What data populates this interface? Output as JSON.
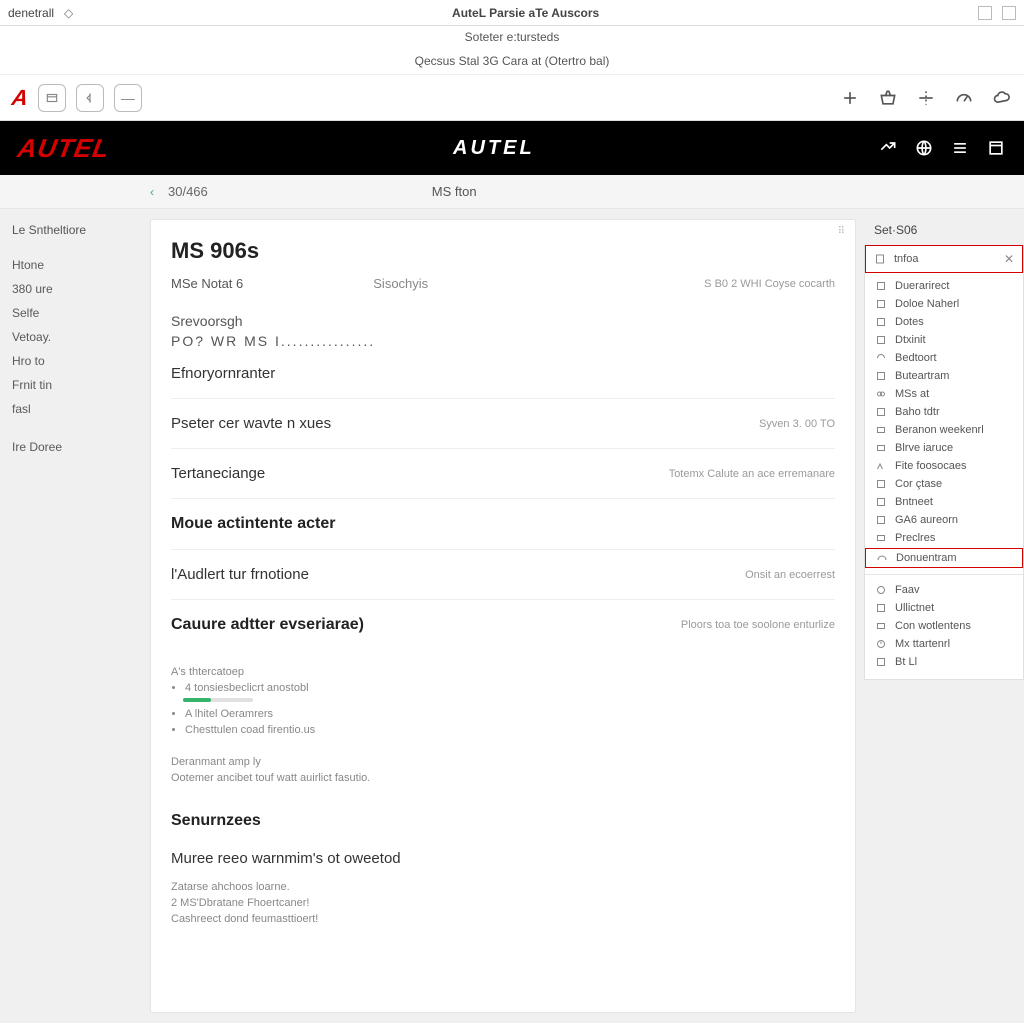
{
  "os": {
    "left_label": "denetrall",
    "window_title": "AuteL Parsie aTe Auscors",
    "subtitle": "Soteter e:tursteds",
    "caption": "Qecsus Stal 3G Cara at (Otertro bal)"
  },
  "site_header": {
    "brand": "AUTEL",
    "brand_center": "AUTEL"
  },
  "crumb": {
    "code": "30/466",
    "page": "MS fton"
  },
  "left_nav": {
    "heading": "Le Sntheltiore",
    "group1": [
      "Htone",
      "380 ure",
      "Selfe",
      "Vetoay.",
      "Hro to",
      "Frnit tin",
      "fasl"
    ],
    "group2": [
      "Ire Doree"
    ]
  },
  "main": {
    "title": "MS 906s",
    "meta1": "MSe Notat 6",
    "meta2": "Sisochyis",
    "meta3": "S B0 2 WHI Coyse cocarth",
    "sub1": "Srevoorsgh",
    "dots": "PO? WR MS I................",
    "sections": [
      {
        "title": "Efnoryornranter",
        "right": ""
      },
      {
        "title": "Pseter cer wavte n xues",
        "right": "Syven 3. 00 TO"
      },
      {
        "title": "Tertaneciange",
        "right": "Totemx Calute an ace erremanare"
      },
      {
        "title": "Moue actintente acter",
        "right": "",
        "big": true
      },
      {
        "title": "l'Audlert tur frnotione",
        "right": "Onsit an ecoerrest"
      },
      {
        "title": "Cauure adtter evseriarae)",
        "right": "Ploors toa toe soolone enturlize",
        "big": true
      }
    ],
    "bullets_title": "A's thtercatoep",
    "bullets": [
      "4 tonsiesbeclicrt anostobl",
      "A lhitel Oeramrers",
      "Chesttulen coad firentio.us"
    ],
    "note1": "Deranmant amp ly",
    "note2": "Ootemer ancibet touf watt auirlict fasutio.",
    "h2": "Senurnzees",
    "h3": "Muree reeo warnmim's ot oweetod",
    "tiny1": "Zatarse ahchoos loarne.",
    "tiny2": "2 MS'Dbratane Fhoertcaner!",
    "tiny3": "Cashreect dond feumasttioert!"
  },
  "right_nav": {
    "title": "Set·S06",
    "header_item": "tnfoa",
    "items1": [
      "Duerarirect",
      "Doloe Naherl",
      "Dotes",
      "Dtxinit",
      "Bedtoort",
      "Buteartram",
      "MSs at",
      "Baho tdtr",
      "Beranon weekenrl",
      "Blrve iaruce",
      "Fite foosocaes",
      "Cor çtase",
      "Bntneet",
      "GA6 aureorn",
      "Preclres"
    ],
    "hl_item": "Donuentram",
    "items2": [
      "Faav",
      "Ullictnet",
      "Con wotlentens",
      "Mx ttartenrl",
      "Bt Ll"
    ]
  }
}
